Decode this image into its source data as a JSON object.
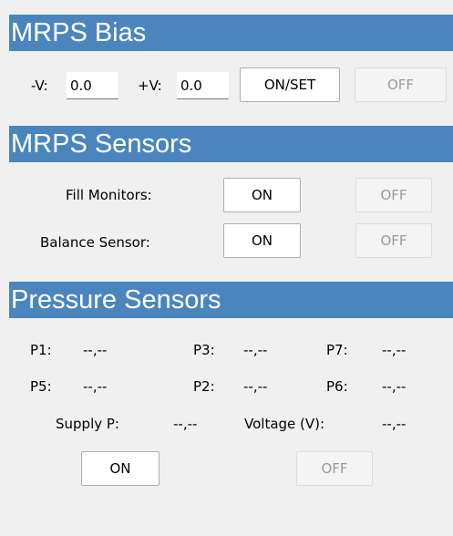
{
  "bias": {
    "title": "MRPS Bias",
    "neg_label": "-V:",
    "neg_value": "0.0",
    "pos_label": "+V:",
    "pos_value": "0.0",
    "on_set_label": "ON/SET",
    "off_label": "OFF"
  },
  "sensors": {
    "title": "MRPS Sensors",
    "fill_label": "Fill Monitors:",
    "fill_on_label": "ON",
    "fill_off_label": "OFF",
    "balance_label": "Balance Sensor:",
    "balance_on_label": "ON",
    "balance_off_label": "OFF"
  },
  "pressure": {
    "title": "Pressure Sensors",
    "readings": [
      {
        "label": "P1:",
        "value": "--,--"
      },
      {
        "label": "P3:",
        "value": "--,--"
      },
      {
        "label": "P7:",
        "value": "--,--"
      },
      {
        "label": "P5:",
        "value": "--,--"
      },
      {
        "label": "P2:",
        "value": "--,--"
      },
      {
        "label": "P6:",
        "value": "--,--"
      }
    ],
    "supply_label": "Supply P:",
    "supply_value": "--,--",
    "voltage_label": "Voltage (V):",
    "voltage_value": "--,--",
    "on_label": "ON",
    "off_label": "OFF"
  },
  "colors": {
    "header_bg": "#4a86bd",
    "header_text": "#ffffff",
    "panel_bg": "#f0f0f0",
    "disabled_text": "#9a9a9a"
  }
}
